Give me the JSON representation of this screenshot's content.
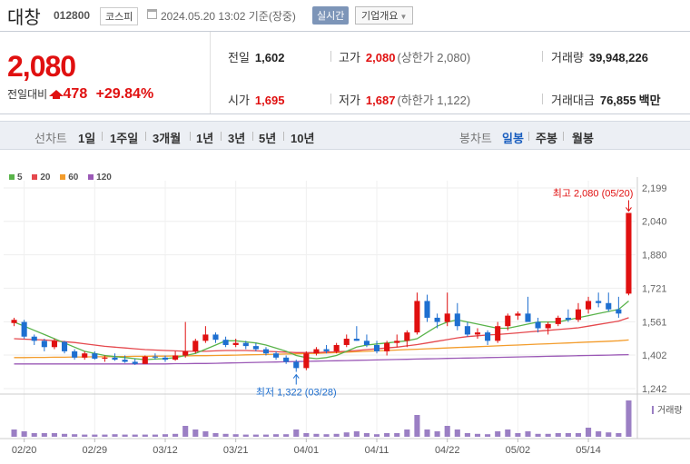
{
  "header": {
    "name": "대창",
    "code": "012800",
    "market": "코스피",
    "datetime": "2024.05.20 13:02  기준(장중)",
    "realtime": "실시간",
    "company_info": "기업개요"
  },
  "summary": {
    "price": "2,080",
    "change_label": "전일대비",
    "change": "478",
    "change_pct": "+29.84%",
    "prev_close_label": "전일",
    "prev_close": "1,602",
    "high_label": "고가",
    "high": "2,080",
    "upper_limit": "(상한가 2,080)",
    "volume_label": "거래량",
    "volume": "39,948,226",
    "open_label": "시가",
    "open": "1,695",
    "low_label": "저가",
    "low": "1,687",
    "lower_limit": "(하한가 1,122)",
    "amount_label": "거래대금",
    "amount": "76,855",
    "amount_unit": "백만"
  },
  "tabs": {
    "line_chart": "선차트",
    "periods": [
      "1일",
      "1주일",
      "3개월",
      "1년",
      "3년",
      "5년",
      "10년"
    ],
    "candle_chart": "봉차트",
    "candle_periods": [
      "일봉",
      "주봉",
      "월봉"
    ],
    "active_candle": "일봉"
  },
  "chart_data": {
    "type": "candlestick",
    "legend": [
      "5",
      "20",
      "60",
      "120"
    ],
    "ma_colors": {
      "5": "#59b34a",
      "20": "#e5484d",
      "60": "#f39c2b",
      "120": "#9b59b6"
    },
    "up_color": "#e01010",
    "down_color": "#1e6fd0",
    "y_ticks": [
      "2,199",
      "2,040",
      "1,880",
      "1,721",
      "1,561",
      "1,402",
      "1,242"
    ],
    "ylim": [
      1242,
      2199
    ],
    "x_ticks": [
      "02/20",
      "02/29",
      "03/12",
      "03/21",
      "04/01",
      "04/11",
      "04/22",
      "05/02",
      "05/14"
    ],
    "x_tick_index": [
      1,
      8,
      15,
      22,
      29,
      36,
      43,
      50,
      57
    ],
    "high_annotation": "최고 2,080 (05/20)",
    "low_annotation": "최저 1,322 (03/28)",
    "volume_label": "거래량",
    "candles": [
      [
        1555,
        1580,
        1540,
        1570
      ],
      [
        1560,
        1570,
        1480,
        1490
      ],
      [
        1490,
        1500,
        1450,
        1470
      ],
      [
        1470,
        1480,
        1420,
        1440
      ],
      [
        1440,
        1480,
        1430,
        1470
      ],
      [
        1465,
        1470,
        1410,
        1420
      ],
      [
        1420,
        1430,
        1380,
        1390
      ],
      [
        1390,
        1420,
        1380,
        1410
      ],
      [
        1410,
        1420,
        1380,
        1385
      ],
      [
        1385,
        1400,
        1370,
        1390
      ],
      [
        1390,
        1410,
        1375,
        1380
      ],
      [
        1380,
        1400,
        1365,
        1370
      ],
      [
        1370,
        1385,
        1355,
        1360
      ],
      [
        1360,
        1400,
        1360,
        1395
      ],
      [
        1395,
        1410,
        1380,
        1390
      ],
      [
        1390,
        1400,
        1370,
        1380
      ],
      [
        1380,
        1420,
        1375,
        1400
      ],
      [
        1400,
        1560,
        1390,
        1420
      ],
      [
        1420,
        1480,
        1410,
        1470
      ],
      [
        1470,
        1540,
        1460,
        1500
      ],
      [
        1500,
        1510,
        1460,
        1475
      ],
      [
        1475,
        1490,
        1440,
        1450
      ],
      [
        1450,
        1480,
        1440,
        1460
      ],
      [
        1460,
        1470,
        1430,
        1445
      ],
      [
        1445,
        1460,
        1420,
        1430
      ],
      [
        1430,
        1440,
        1400,
        1410
      ],
      [
        1410,
        1420,
        1380,
        1390
      ],
      [
        1390,
        1400,
        1360,
        1370
      ],
      [
        1370,
        1380,
        1322,
        1340
      ],
      [
        1340,
        1420,
        1330,
        1410
      ],
      [
        1410,
        1440,
        1400,
        1430
      ],
      [
        1430,
        1450,
        1410,
        1420
      ],
      [
        1420,
        1460,
        1410,
        1450
      ],
      [
        1450,
        1500,
        1440,
        1480
      ],
      [
        1480,
        1540,
        1470,
        1470
      ],
      [
        1470,
        1500,
        1440,
        1450
      ],
      [
        1450,
        1470,
        1410,
        1420
      ],
      [
        1420,
        1470,
        1400,
        1460
      ],
      [
        1460,
        1500,
        1440,
        1470
      ],
      [
        1470,
        1520,
        1440,
        1510
      ],
      [
        1510,
        1700,
        1500,
        1660
      ],
      [
        1660,
        1690,
        1560,
        1580
      ],
      [
        1580,
        1600,
        1530,
        1560
      ],
      [
        1560,
        1700,
        1540,
        1600
      ],
      [
        1600,
        1650,
        1520,
        1540
      ],
      [
        1540,
        1560,
        1490,
        1500
      ],
      [
        1500,
        1530,
        1480,
        1510
      ],
      [
        1510,
        1520,
        1450,
        1470
      ],
      [
        1470,
        1560,
        1460,
        1540
      ],
      [
        1540,
        1600,
        1520,
        1590
      ],
      [
        1590,
        1610,
        1570,
        1600
      ],
      [
        1600,
        1680,
        1580,
        1560
      ],
      [
        1560,
        1580,
        1510,
        1530
      ],
      [
        1530,
        1560,
        1500,
        1550
      ],
      [
        1550,
        1590,
        1540,
        1580
      ],
      [
        1580,
        1620,
        1560,
        1570
      ],
      [
        1570,
        1650,
        1560,
        1620
      ],
      [
        1620,
        1680,
        1600,
        1660
      ],
      [
        1660,
        1700,
        1630,
        1650
      ],
      [
        1650,
        1700,
        1610,
        1620
      ],
      [
        1620,
        1680,
        1580,
        1600
      ],
      [
        1695,
        2080,
        1687,
        2080
      ]
    ],
    "ma5": [
      1560,
      1540,
      1520,
      1500,
      1480,
      1460,
      1440,
      1420,
      1410,
      1400,
      1395,
      1390,
      1385,
      1380,
      1383,
      1385,
      1390,
      1400,
      1410,
      1430,
      1450,
      1470,
      1470,
      1465,
      1460,
      1450,
      1435,
      1420,
      1400,
      1390,
      1385,
      1390,
      1400,
      1420,
      1440,
      1450,
      1455,
      1460,
      1465,
      1470,
      1480,
      1510,
      1540,
      1560,
      1570,
      1560,
      1550,
      1540,
      1530,
      1530,
      1540,
      1550,
      1560,
      1560,
      1560,
      1570,
      1580,
      1590,
      1600,
      1610,
      1620,
      1660
    ],
    "ma20": [
      1480,
      1478,
      1476,
      1474,
      1470,
      1466,
      1462,
      1456,
      1450,
      1444,
      1440,
      1436,
      1432,
      1428,
      1426,
      1424,
      1422,
      1420,
      1420,
      1420,
      1422,
      1424,
      1424,
      1424,
      1422,
      1420,
      1418,
      1416,
      1414,
      1414,
      1414,
      1416,
      1418,
      1420,
      1424,
      1428,
      1432,
      1436,
      1440,
      1446,
      1452,
      1460,
      1468,
      1476,
      1484,
      1490,
      1494,
      1498,
      1500,
      1504,
      1508,
      1512,
      1516,
      1520,
      1524,
      1528,
      1532,
      1540,
      1548,
      1556,
      1564,
      1580
    ],
    "ma60": [
      1390,
      1390,
      1391,
      1391,
      1392,
      1392,
      1393,
      1393,
      1394,
      1394,
      1395,
      1395,
      1396,
      1396,
      1397,
      1397,
      1398,
      1398,
      1399,
      1399,
      1400,
      1401,
      1402,
      1403,
      1404,
      1405,
      1406,
      1407,
      1408,
      1409,
      1410,
      1412,
      1414,
      1416,
      1418,
      1420,
      1422,
      1424,
      1426,
      1428,
      1430,
      1432,
      1434,
      1436,
      1438,
      1440,
      1442,
      1444,
      1446,
      1448,
      1450,
      1452,
      1454,
      1456,
      1458,
      1460,
      1462,
      1464,
      1466,
      1468,
      1470,
      1474
    ],
    "ma120": [
      1360,
      1360,
      1360,
      1360,
      1360,
      1360,
      1360,
      1360,
      1360,
      1360,
      1360,
      1360,
      1360,
      1360,
      1360,
      1360,
      1361,
      1361,
      1362,
      1362,
      1363,
      1364,
      1365,
      1366,
      1367,
      1368,
      1369,
      1370,
      1371,
      1372,
      1373,
      1374,
      1375,
      1376,
      1377,
      1378,
      1379,
      1380,
      1381,
      1382,
      1383,
      1384,
      1385,
      1386,
      1387,
      1388,
      1389,
      1390,
      1391,
      1392,
      1393,
      1394,
      1395,
      1396,
      1397,
      1398,
      1399,
      1400,
      1401,
      1402,
      1403,
      1404
    ],
    "volume": [
      0.2,
      0.15,
      0.1,
      0.1,
      0.1,
      0.08,
      0.07,
      0.06,
      0.06,
      0.06,
      0.07,
      0.06,
      0.06,
      0.06,
      0.06,
      0.07,
      0.08,
      0.3,
      0.2,
      0.15,
      0.1,
      0.08,
      0.07,
      0.06,
      0.06,
      0.06,
      0.07,
      0.07,
      0.2,
      0.1,
      0.08,
      0.07,
      0.08,
      0.12,
      0.15,
      0.1,
      0.07,
      0.1,
      0.1,
      0.2,
      0.6,
      0.2,
      0.15,
      0.3,
      0.2,
      0.1,
      0.08,
      0.07,
      0.15,
      0.2,
      0.1,
      0.15,
      0.08,
      0.08,
      0.1,
      0.1,
      0.1,
      0.25,
      0.15,
      0.12,
      0.1,
      1.0
    ]
  }
}
